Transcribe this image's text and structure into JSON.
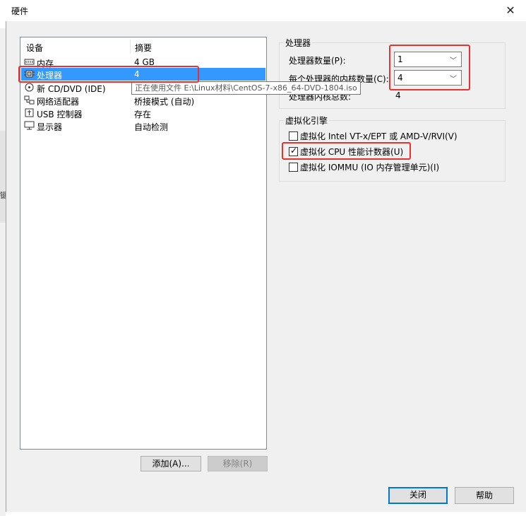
{
  "window": {
    "title": "硬件"
  },
  "devices": {
    "header_device": "设备",
    "header_summary": "摘要",
    "items": [
      {
        "icon": "memory-icon",
        "name": "内存",
        "summary": "4 GB"
      },
      {
        "icon": "processor-icon",
        "name": "处理器",
        "summary": "4"
      },
      {
        "icon": "cd-dvd-icon",
        "name": "新 CD/DVD (IDE)",
        "summary": ""
      },
      {
        "icon": "network-adapter-icon",
        "name": "网络适配器",
        "summary": "桥接模式 (自动)"
      },
      {
        "icon": "usb-controller-icon",
        "name": "USB 控制器",
        "summary": "存在"
      },
      {
        "icon": "display-icon",
        "name": "显示器",
        "summary": "自动检测"
      }
    ],
    "tooltip": "正在使用文件 E:\\Linux材料\\CentOS-7-x86_64-DVD-1804.iso"
  },
  "buttons": {
    "add": "添加(A)...",
    "remove": "移除(R)",
    "close": "关闭",
    "help": "帮助"
  },
  "processor": {
    "group_title": "处理器",
    "count_label": "处理器数量(P):",
    "count_value": "1",
    "cores_label": "每个处理器的内核数量(C):",
    "cores_value": "4",
    "total_label": "处理器内核总数:",
    "total_value": "4"
  },
  "virtualization": {
    "group_title": "虚拟化引擎",
    "options": [
      {
        "label": "虚拟化 Intel VT-x/EPT 或 AMD-V/RVI(V)",
        "checked": false
      },
      {
        "label": "虚拟化 CPU 性能计数器(U)",
        "checked": true
      },
      {
        "label": "虚拟化 IOMMU (IO 内存管理单元)(I)",
        "checked": false
      }
    ]
  },
  "colors": {
    "selection": "#3399ff",
    "highlight_annotation": "#e8322f",
    "default_button_border": "#0078d7"
  }
}
